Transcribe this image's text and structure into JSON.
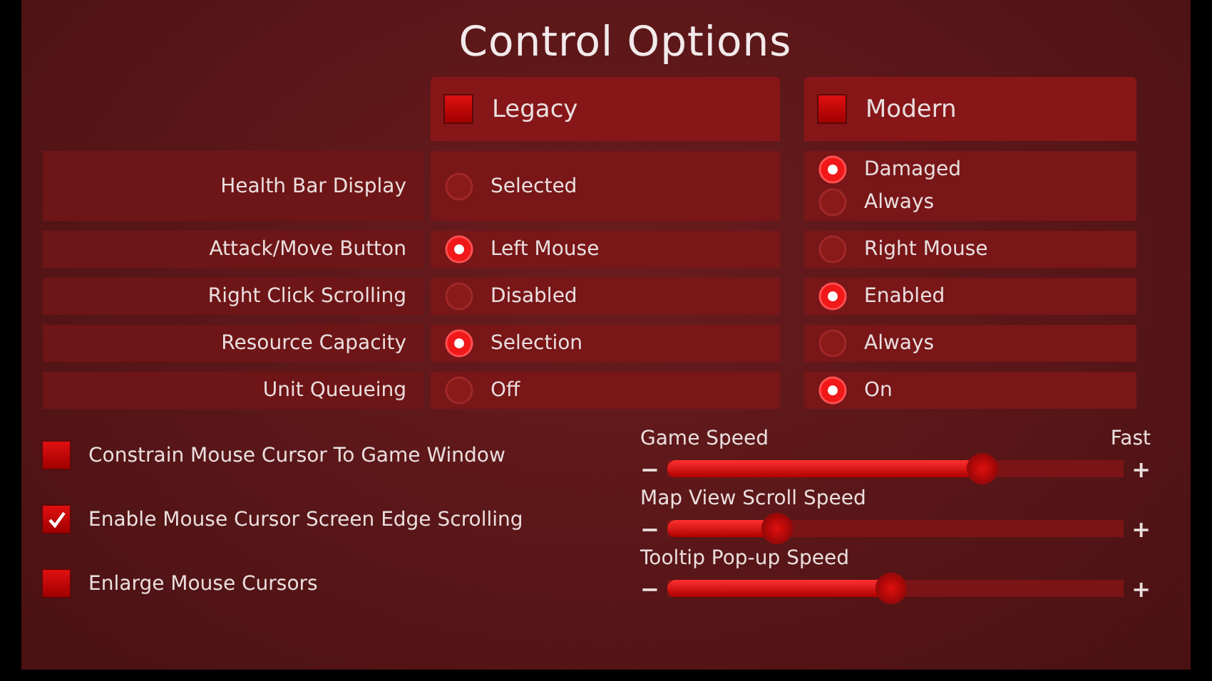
{
  "title": "Control Options",
  "schemes": [
    {
      "label": "Legacy",
      "checked": false
    },
    {
      "label": "Modern",
      "checked": false
    }
  ],
  "settings": [
    {
      "label": "Health Bar Display",
      "legacy": [
        {
          "label": "Selected",
          "selected": false
        }
      ],
      "modern": [
        {
          "label": "Damaged",
          "selected": true
        },
        {
          "label": "Always",
          "selected": false
        }
      ]
    },
    {
      "label": "Attack/Move Button",
      "legacy": [
        {
          "label": "Left Mouse",
          "selected": true
        }
      ],
      "modern": [
        {
          "label": "Right Mouse",
          "selected": false
        }
      ]
    },
    {
      "label": "Right Click Scrolling",
      "legacy": [
        {
          "label": "Disabled",
          "selected": false
        }
      ],
      "modern": [
        {
          "label": "Enabled",
          "selected": true
        }
      ]
    },
    {
      "label": "Resource Capacity",
      "legacy": [
        {
          "label": "Selection",
          "selected": true
        }
      ],
      "modern": [
        {
          "label": "Always",
          "selected": false
        }
      ]
    },
    {
      "label": "Unit Queueing",
      "legacy": [
        {
          "label": "Off",
          "selected": false
        }
      ],
      "modern": [
        {
          "label": "On",
          "selected": true
        }
      ]
    }
  ],
  "checkboxes": [
    {
      "label": "Constrain Mouse Cursor To Game Window",
      "checked": false
    },
    {
      "label": "Enable Mouse Cursor Screen Edge Scrolling",
      "checked": true
    },
    {
      "label": "Enlarge Mouse Cursors",
      "checked": false
    }
  ],
  "sliders": [
    {
      "label": "Game Speed",
      "value_label": "Fast",
      "minus": "−",
      "plus": "+",
      "level": 0.69
    },
    {
      "label": "Map View Scroll Speed",
      "minus": "−",
      "plus": "+",
      "level": 0.24
    },
    {
      "label": "Tooltip Pop-up Speed",
      "minus": "−",
      "plus": "+",
      "level": 0.49
    }
  ]
}
